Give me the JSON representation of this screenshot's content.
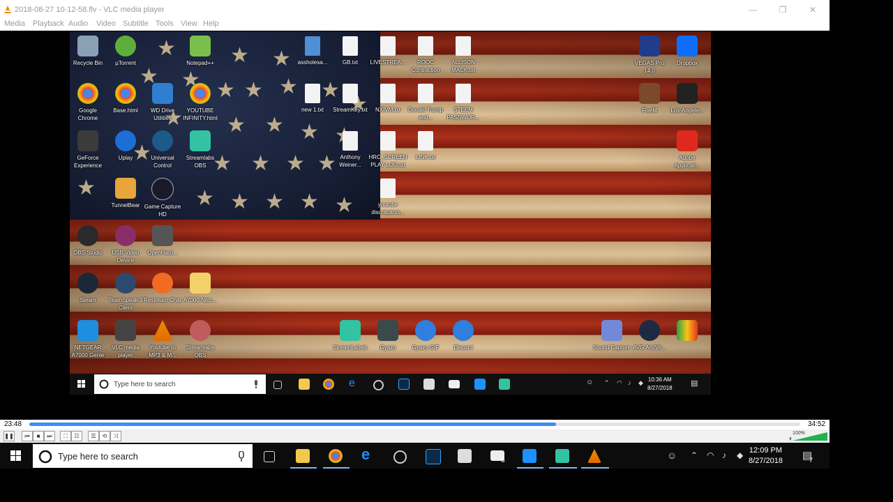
{
  "window": {
    "title": "2018-08-27 10-12-58.flv - VLC media player",
    "minimize_glyph": "—",
    "restore_glyph": "❐",
    "close_glyph": "✕"
  },
  "menu": [
    "Media",
    "Playback",
    "Audio",
    "Video",
    "Subtitle",
    "Tools",
    "View",
    "Help"
  ],
  "desktop_icons": [
    {
      "label": "Recycle Bin"
    },
    {
      "label": "µTorrent"
    },
    {
      "label": "Notepad++"
    },
    {
      "label": "assholesa..."
    },
    {
      "label": "GB.txt"
    },
    {
      "label": "LIVESTREA..."
    },
    {
      "label": "ROOC Contraction"
    },
    {
      "label": "ALLISON MACK.txt"
    },
    {
      "label": "VEGAS Pro 14.0"
    },
    {
      "label": "Dropbox"
    },
    {
      "label": "Google Chrome"
    },
    {
      "label": "Base.html"
    },
    {
      "label": "WD Drive Utilities"
    },
    {
      "label": "YOUTUBE INFINITY.html"
    },
    {
      "label": "new 1.txt"
    },
    {
      "label": "StreamKey.txt"
    },
    {
      "label": "NXIVM.txt"
    },
    {
      "label": "Donald Trump and..."
    },
    {
      "label": "STEEM PASSWOR..."
    },
    {
      "label": "FiveM"
    },
    {
      "label": "Los-Angele..."
    },
    {
      "label": "GeForce Experience"
    },
    {
      "label": "Uplay"
    },
    {
      "label": "Universal Control"
    },
    {
      "label": "Streamlabs OBS"
    },
    {
      "label": "Anthony Weiner..."
    },
    {
      "label": "HRC_SCREEN PLAY LOG.txt"
    },
    {
      "label": "LINK.txt"
    },
    {
      "label": "Adobe Applicati..."
    },
    {
      "label": "TunnelBear"
    },
    {
      "label": "Game Capture HD"
    },
    {
      "label": "youtube discrepanci..."
    },
    {
      "label": "OBS Studio"
    },
    {
      "label": "USB Video Device"
    },
    {
      "label": "OpenHard..."
    },
    {
      "label": "Steam"
    },
    {
      "label": "TeamSpeak 3 Client"
    },
    {
      "label": "Restream Chat"
    },
    {
      "label": "A7000 Netc..."
    },
    {
      "label": "RealPlayer (RealTimes)"
    },
    {
      "label": "NETGEAR A7000 Genie"
    },
    {
      "label": "VLC media player"
    },
    {
      "label": "Youtube to MP3 & M..."
    },
    {
      "label": "Streamlabs OBS"
    },
    {
      "label": "StreamLabels"
    },
    {
      "label": "Gyazo"
    },
    {
      "label": "Gyazo GIF"
    },
    {
      "label": "Discord"
    },
    {
      "label": "Sound Capture"
    },
    {
      "label": "AVG AntiVir..."
    }
  ],
  "inner_taskbar": {
    "search_placeholder": "Type here to search",
    "time": "10:36 AM",
    "date": "8/27/2018",
    "mail_badge": "6"
  },
  "player": {
    "elapsed": "23:48",
    "total": "34:52",
    "progress": 0.683,
    "volume": "100%",
    "volume_level": 1.0,
    "buttons": {
      "pause": "❚❚",
      "prev": "⏮",
      "stop": "■",
      "next": "⏭",
      "fullscreen": "⛶",
      "extended": "☷",
      "playlist": "☰",
      "loop": "⟲",
      "shuffle": "⤨"
    }
  },
  "outer_taskbar": {
    "search_placeholder": "Type here to search",
    "time": "12:09 PM",
    "date": "8/27/2018",
    "mail_badge": "6",
    "notification_count": "7"
  },
  "colors": {
    "progress_fill": "#3c8ff2",
    "taskbar": "#0c0c0c",
    "accent": "#7cb8ff"
  }
}
